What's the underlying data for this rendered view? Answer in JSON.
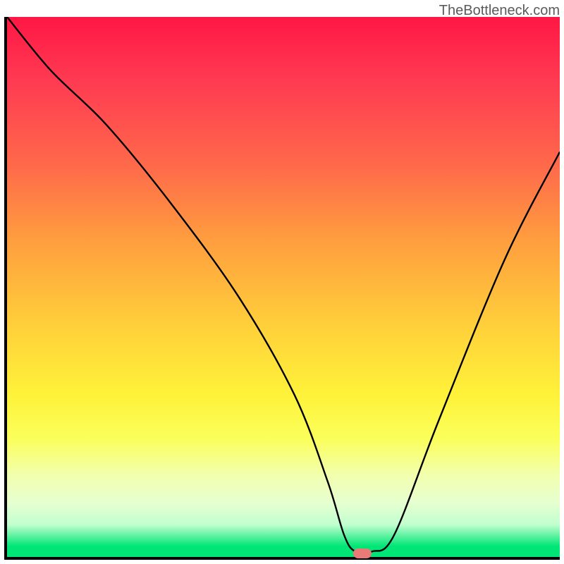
{
  "watermark": "TheBottleneck.com",
  "colors": {
    "top": "#ff1744",
    "mid": "#ffd23a",
    "bottom": "#00e676",
    "border": "#000000",
    "curve": "#000000",
    "marker": "#e87a78"
  },
  "chart_data": {
    "type": "line",
    "title": "",
    "xlabel": "",
    "ylabel": "",
    "xlim": [
      0,
      100
    ],
    "ylim": [
      0,
      100
    ],
    "grid": false,
    "gradient": "red-yellow-green vertical (top=bad, bottom=good)",
    "series": [
      {
        "name": "bottleneck-curve",
        "x_pct": [
          0,
          8,
          18,
          30,
          42,
          52,
          58,
          61,
          63,
          66,
          70,
          78,
          90,
          100
        ],
        "y_pct": [
          100,
          90,
          80,
          65,
          48,
          30,
          14,
          4,
          1,
          1,
          4,
          25,
          55,
          75
        ],
        "note": "y_pct is distance from bottom of plot area (0 = bottom/green, 100 = top/red)"
      }
    ],
    "marker": {
      "x_pct": 64,
      "y_pct": 1.2,
      "shape": "pill",
      "color": "#e87a78"
    }
  }
}
